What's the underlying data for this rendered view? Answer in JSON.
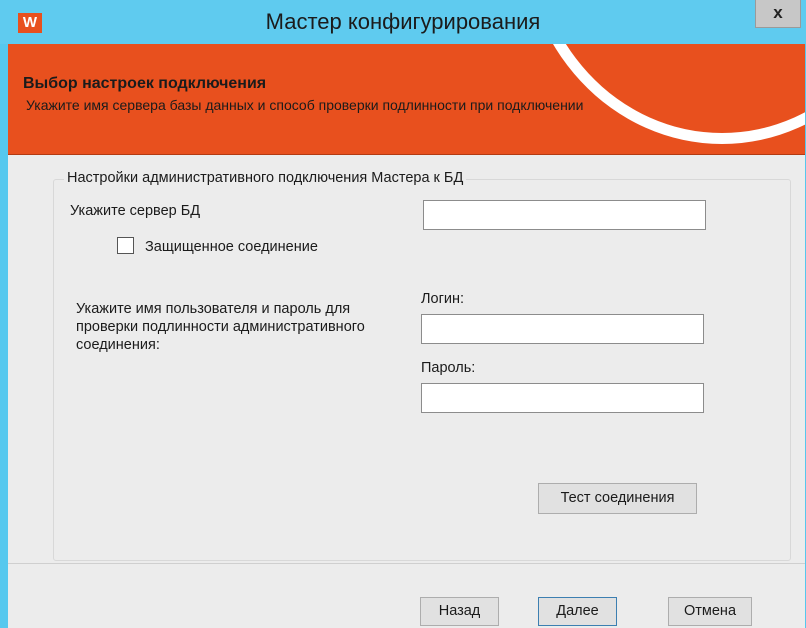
{
  "window": {
    "title": "Мастер конфигурирования",
    "app_icon_letter": "W",
    "close_label": "x"
  },
  "header": {
    "title": "Выбор настроек подключения",
    "subtitle": "Укажите имя сервера базы данных и способ проверки подлинности при подключении",
    "accent_color": "#e8501e"
  },
  "group": {
    "legend": "Настройки административного подключения Мастера к БД",
    "server_label": "Укажите сервер БД",
    "server_value": "",
    "secure_label": "Защищенное соединение",
    "secure_checked": false,
    "auth_description": "Укажите имя пользователя и пароль для проверки подлинности административного соединения:",
    "login_label": "Логин:",
    "login_value": "",
    "password_label": "Пароль:",
    "password_value": "",
    "test_button": "Тест соединения"
  },
  "footer": {
    "back": "Назад",
    "next": "Далее",
    "cancel": "Отмена"
  }
}
